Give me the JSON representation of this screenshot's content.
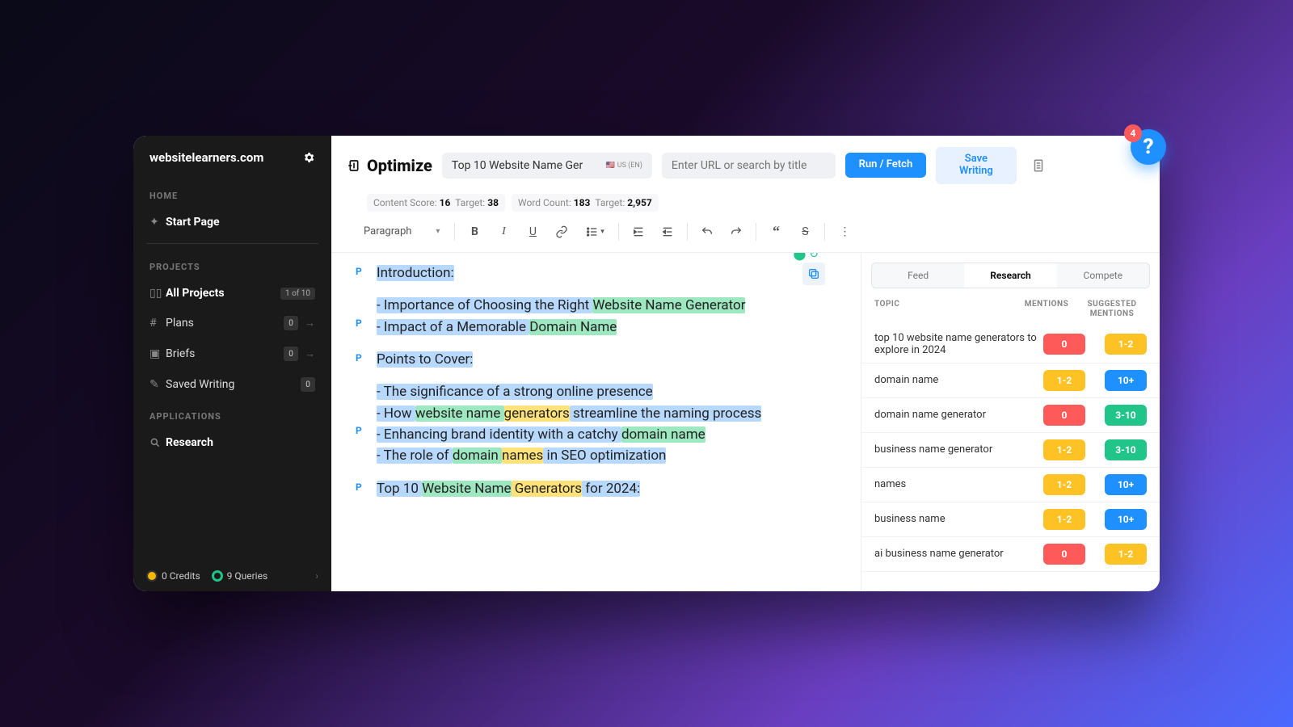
{
  "sidebar": {
    "site_name": "websitelearners.com",
    "home_label": "HOME",
    "start_page": "Start Page",
    "projects_label": "PROJECTS",
    "all_projects": "All Projects",
    "all_projects_badge": "1 of 10",
    "plans": "Plans",
    "plans_count": "0",
    "briefs": "Briefs",
    "briefs_count": "0",
    "saved_writing": "Saved Writing",
    "saved_writing_count": "0",
    "applications_label": "APPLICATIONS",
    "research": "Research",
    "footer_credits": "0 Credits",
    "footer_queries": "9 Queries"
  },
  "topbar": {
    "title": "Optimize",
    "doc_title": "Top 10 Website Name Ger",
    "locale": "US (EN)",
    "url_placeholder": "Enter URL or search by title",
    "run_btn": "Run / Fetch",
    "save_btn": "Save Writing"
  },
  "metrics": {
    "content_score_label": "Content Score:",
    "content_score": "16",
    "cs_target_label": "Target:",
    "cs_target": "38",
    "word_count_label": "Word Count:",
    "word_count": "183",
    "wc_target_label": "Target:",
    "wc_target": "2,957"
  },
  "toolbar": {
    "para_label": "Paragraph"
  },
  "editor": {
    "p1_a": "Introduction:",
    "p2_a": "- Importance of Choosing the Right ",
    "p2_b": "Website Name Generator",
    "p2_c": "- Impact of a Memorable ",
    "p2_d": "Domain Name",
    "p3_a": "Points to Cover:",
    "p4_a": "- The significance of a strong online presence",
    "p4_b": "- How ",
    "p4_c": "website name ",
    "p4_d": "generators",
    "p4_e": " streamline the naming process",
    "p4_f": "- Enhancing brand identity with a catchy ",
    "p4_g": "domain name",
    "p4_h": "- The role of ",
    "p4_i": "domain ",
    "p4_j": "names",
    "p4_k": " in SEO optimization",
    "p5_a": "Top 10 ",
    "p5_b": "Website Name",
    "p5_c": " Generators",
    "p5_d": " for 2024:"
  },
  "research": {
    "tab_feed": "Feed",
    "tab_research": "Research",
    "tab_compete": "Compete",
    "col_topic": "TOPIC",
    "col_mentions": "MENTIONS",
    "col_suggested": "SUGGESTED MENTIONS",
    "rows": [
      {
        "topic": "top 10 website name generators to explore in 2024",
        "mentions": "0",
        "m_color": "red",
        "suggested": "1-2",
        "s_color": "yellow"
      },
      {
        "topic": "domain name",
        "mentions": "1-2",
        "m_color": "yellow",
        "suggested": "10+",
        "s_color": "blue"
      },
      {
        "topic": "domain name generator",
        "mentions": "0",
        "m_color": "red",
        "suggested": "3-10",
        "s_color": "green"
      },
      {
        "topic": "business name generator",
        "mentions": "1-2",
        "m_color": "yellow",
        "suggested": "3-10",
        "s_color": "green"
      },
      {
        "topic": "names",
        "mentions": "1-2",
        "m_color": "yellow",
        "suggested": "10+",
        "s_color": "blue"
      },
      {
        "topic": "business name",
        "mentions": "1-2",
        "m_color": "yellow",
        "suggested": "10+",
        "s_color": "blue"
      },
      {
        "topic": "ai business name generator",
        "mentions": "0",
        "m_color": "red",
        "suggested": "1-2",
        "s_color": "yellow"
      }
    ]
  },
  "help": {
    "badge": "4",
    "q": "?"
  }
}
